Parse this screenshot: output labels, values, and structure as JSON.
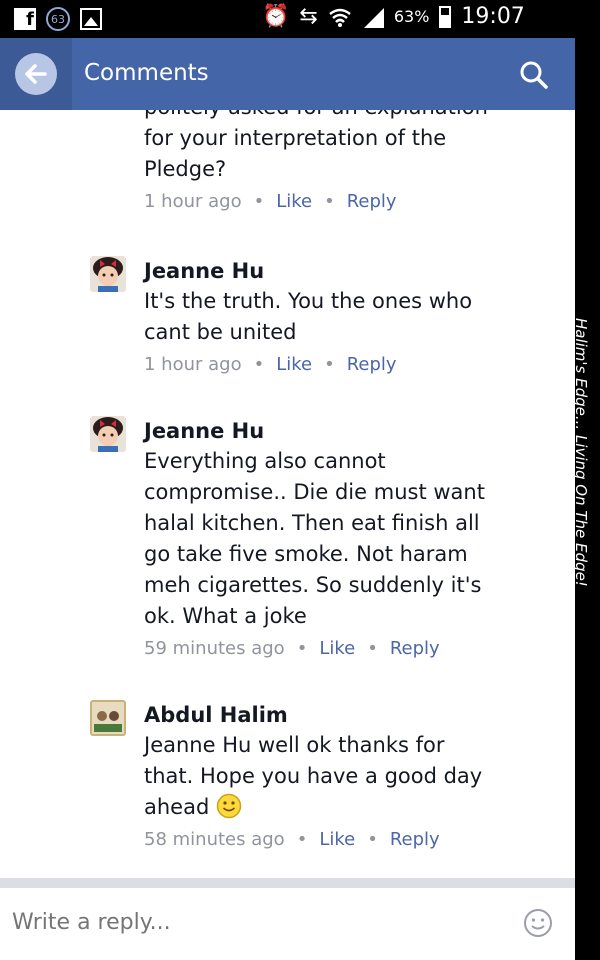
{
  "status_bar": {
    "notification_count": "63",
    "battery_percent": "63%",
    "time": "19:07",
    "icons": [
      "facebook-icon",
      "notification-badge",
      "image-icon",
      "alarm-icon",
      "data-transfer-icon",
      "wifi-icon",
      "signal-icon",
      "battery-icon"
    ]
  },
  "app_bar": {
    "title": "Comments",
    "back_icon": "back-arrow-icon",
    "search_icon": "search-icon"
  },
  "comments": [
    {
      "name": "",
      "text": "politely asked for an explanation\nfor your interpretation of the\nPledge?",
      "time": "1 hour ago",
      "like": "Like",
      "reply": "Reply"
    },
    {
      "name": "Jeanne Hu",
      "text": "It's the truth. You the ones who\ncant be united",
      "time": "1 hour ago",
      "like": "Like",
      "reply": "Reply"
    },
    {
      "name": "Jeanne Hu",
      "text": "Everything also cannot\ncompromise.. Die die must want\nhalal kitchen. Then eat finish all\ngo take five smoke. Not haram\nmeh cigarettes. So suddenly it's\nok. What a joke",
      "time": "59 minutes ago",
      "like": "Like",
      "reply": "Reply"
    },
    {
      "name": "Abdul Halim",
      "text": "Jeanne Hu well ok thanks for\nthat. Hope you have a good day\nahead",
      "time": "58 minutes ago",
      "like": "Like",
      "reply": "Reply"
    }
  ],
  "watermark": "Halim's Edge... Living On The Edge!",
  "reply_bar": {
    "placeholder": "Write a reply...",
    "emoji_icon": "smiley-icon"
  },
  "colors": {
    "app_bar": "#4466a8",
    "link": "#4b67a8",
    "meta": "#90949c"
  }
}
